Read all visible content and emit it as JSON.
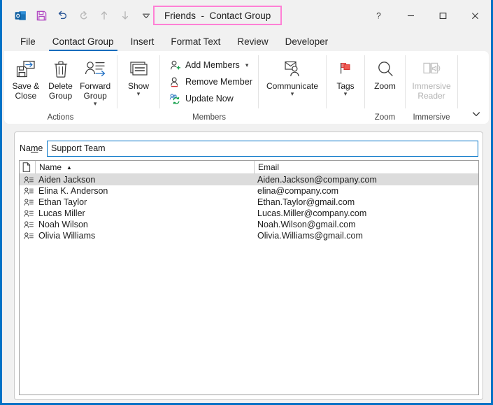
{
  "window": {
    "title": "Friends  -  Contact Group",
    "title_highlight_color": "#ff80d5",
    "border_color": "#0072C6"
  },
  "quick_access": {
    "items": [
      {
        "name": "outlook-logo-icon",
        "label": "Outlook"
      },
      {
        "name": "save-icon",
        "label": "Save"
      },
      {
        "name": "undo-icon",
        "label": "Undo"
      },
      {
        "name": "redo-icon",
        "label": "Redo"
      },
      {
        "name": "previous-item-icon",
        "label": "Previous Item"
      },
      {
        "name": "next-item-icon",
        "label": "Next Item"
      },
      {
        "name": "customize-qat-icon",
        "label": "Customize Quick Access Toolbar"
      }
    ]
  },
  "window_controls": {
    "help": "?",
    "minimize": "—",
    "maximize": "☐",
    "close": "✕"
  },
  "ribbon": {
    "tabs": [
      {
        "label": "File",
        "active": false
      },
      {
        "label": "Contact Group",
        "active": true
      },
      {
        "label": "Insert",
        "active": false
      },
      {
        "label": "Format Text",
        "active": false
      },
      {
        "label": "Review",
        "active": false
      },
      {
        "label": "Developer",
        "active": false
      }
    ],
    "groups": [
      {
        "label": "Actions",
        "buttons": [
          {
            "label": "Save &\nClose",
            "icon": "save-and-close-icon",
            "caret": false,
            "disabled": false
          },
          {
            "label": "Delete\nGroup",
            "icon": "delete-group-icon",
            "caret": false,
            "disabled": false
          },
          {
            "label": "Forward\nGroup",
            "icon": "forward-group-icon",
            "caret": true,
            "disabled": false
          }
        ]
      },
      {
        "label": "",
        "buttons": [
          {
            "label": "Show",
            "icon": "show-icon",
            "caret": true,
            "disabled": false
          }
        ]
      },
      {
        "label": "Members",
        "small_buttons": [
          {
            "label": "Add Members",
            "icon": "add-members-icon",
            "caret": true
          },
          {
            "label": "Remove Member",
            "icon": "remove-member-icon",
            "caret": false
          },
          {
            "label": "Update Now",
            "icon": "update-now-icon",
            "caret": false
          }
        ]
      },
      {
        "label": "",
        "buttons": [
          {
            "label": "Communicate",
            "icon": "communicate-icon",
            "caret": true,
            "disabled": false
          }
        ]
      },
      {
        "label": "",
        "buttons": [
          {
            "label": "Tags",
            "icon": "tags-flag-icon",
            "caret": true,
            "disabled": false
          }
        ]
      },
      {
        "label": "Zoom",
        "buttons": [
          {
            "label": "Zoom",
            "icon": "zoom-magnifier-icon",
            "caret": false,
            "disabled": false
          }
        ]
      },
      {
        "label": "Immersive",
        "buttons": [
          {
            "label": "Immersive\nReader",
            "icon": "immersive-reader-icon",
            "caret": false,
            "disabled": true
          }
        ]
      }
    ],
    "collapse_label": "Collapse the Ribbon"
  },
  "form": {
    "name_label_pre": "Na",
    "name_label_accel": "m",
    "name_label_post": "e",
    "name_value": "Support Team",
    "name_placeholder": ""
  },
  "members_list": {
    "columns": [
      {
        "key": "attachment",
        "label": ""
      },
      {
        "key": "name",
        "label": "Name",
        "sorted": "asc",
        "sort_glyph": "▲"
      },
      {
        "key": "email",
        "label": "Email",
        "sorted": "",
        "sort_glyph": ""
      }
    ],
    "rows": [
      {
        "name": "Aiden Jackson",
        "email": "Aiden.Jackson@company.com",
        "selected": true
      },
      {
        "name": "Elina K. Anderson",
        "email": "elina@company.com",
        "selected": false
      },
      {
        "name": "Ethan Taylor",
        "email": "Ethan.Taylor@gmail.com",
        "selected": false
      },
      {
        "name": "Lucas Miller",
        "email": "Lucas.Miller@company.com",
        "selected": false
      },
      {
        "name": "Noah Wilson",
        "email": "Noah.Wilson@gmail.com",
        "selected": false
      },
      {
        "name": "Olivia Williams",
        "email": "Olivia.Williams@gmail.com",
        "selected": false
      }
    ]
  }
}
